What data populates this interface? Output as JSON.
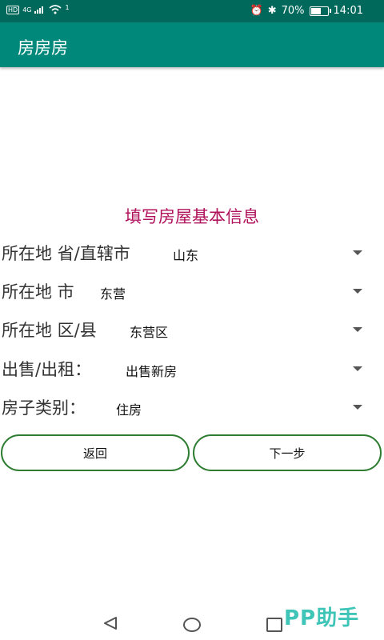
{
  "status_bar": {
    "network_hd": "HD",
    "network_4g": "4G",
    "wifi_badge": "1",
    "battery_percent": "70%",
    "battery_level": 0.7,
    "time": "14:01"
  },
  "app_bar": {
    "title": "房房房"
  },
  "form": {
    "title": "填写房屋基本信息",
    "rows": [
      {
        "label": "所在地 省/直辖市",
        "value": "山东"
      },
      {
        "label": "所在地 市",
        "value": "东营"
      },
      {
        "label": "所在地 区/县",
        "value": "东营区"
      },
      {
        "label": "出售/出租：",
        "value": "出售新房"
      },
      {
        "label": "房子类别：",
        "value": "住房"
      }
    ]
  },
  "buttons": {
    "back": "返回",
    "next": "下一步"
  },
  "watermark": "PP助手",
  "colors": {
    "app_bar": "#00897b",
    "status_bar": "#00695c",
    "title": "#b0125b",
    "button_border": "#2e7d32"
  }
}
